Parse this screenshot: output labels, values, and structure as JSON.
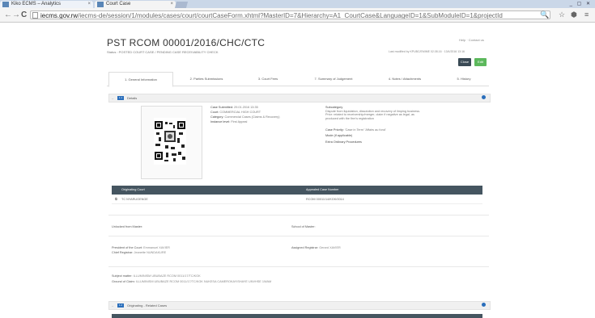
{
  "browser": {
    "tabs": [
      {
        "label": "Kiko ECMS – Analytics"
      },
      {
        "label": "Court Case"
      }
    ],
    "url_host": "iecms.gov.rw",
    "url_path": "/iecms-de/session/1/modules/cases/court/courtCaseForm.xhtml?MasterID=7&Hierarchy=A1_CourtCase&LanguageID=1&SubModuleID=1&projectId"
  },
  "page": {
    "title": "PST RCOM 00001/2016/CHC/CTC",
    "status": "Status : POSTED COURT CASE / PENDING CASE RECEIVABILITY CHECK",
    "help_links": "Help · Contact us",
    "last_modified": "Last modified by KPUBC/EMIME 02.08.16 · 13/4/2016 13:16",
    "close_label": "Close",
    "edit_label": "Edit"
  },
  "tabs": [
    {
      "label": "1. General Information"
    },
    {
      "label": "2. Parties Submissions"
    },
    {
      "label": "3. Court Fees"
    },
    {
      "label": "7. Summary of Judgement"
    },
    {
      "label": "4. Notes / Attachments"
    },
    {
      "label": "5. History"
    }
  ],
  "details": {
    "badge": "1.1",
    "header": "Details",
    "fields": [
      {
        "label": "Case Submitted:",
        "value": "29.01.2016 13:35"
      },
      {
        "label": "Court:",
        "value": "COMMERCIAL HIGH COURT"
      },
      {
        "label": "Category:",
        "value": "Commercial Cases (Claims & Recovery)"
      },
      {
        "label": "Instance level:",
        "value": "First Appeal"
      }
    ],
    "subcategory_label": "Subcategory",
    "subcategory_value": "Dispute from liquidation, dissolution and recovery of limping business. Prior: related to receivership/merger, claim if negative as legal, as produced with the firm's registration",
    "priority_label": "Case Priority:",
    "priority_value": "'Case in Term' 'Affairs au fond'",
    "other_label": "Mode (if applicable)",
    "extraordinary_label": "Extra Ordinary Procedures"
  },
  "origin_table": {
    "headers": [
      "Originating Court",
      "Appealed Case Number"
    ],
    "rows": [
      [
        "TC NYARUGENGE",
        "RCOM 00011/14/KGK/0014"
      ]
    ]
  },
  "sections": {
    "unlocked_from": "Unlocked from Master:",
    "school_of_master": "School of Master:",
    "president_label": "President of the Court:",
    "president_value": "Emmanuel XAVIER",
    "chief_registrar_label": "Chief Registrar:",
    "chief_registrar_value": "Jeanette NUNDAKURE",
    "assigned_registrar_label": "Assigned Registrar:",
    "assigned_registrar_value": "Gerard XAVIER",
    "subject_label": "Subject matter:",
    "subject_value": "ILLUMINISM UBUBAZE RCOM 0011/17/TC/KGK",
    "grounds_label": "Ground of Claim:",
    "grounds_value": "ILLUMINISM UBUBAZE RCOM 0011/17/TC/KGK NUKESA CAMEROKAYISHAYE UNVHSE 1WAM"
  },
  "originating": {
    "badge": "1.2",
    "header": "Originating - Related Cases"
  },
  "icons": [
    "back-arrow-icon",
    "forward-arrow-icon",
    "reload-icon",
    "page-icon",
    "search-icon",
    "star-icon",
    "extension-icon",
    "menu-icon",
    "info-icon",
    "qr-code-icon"
  ]
}
